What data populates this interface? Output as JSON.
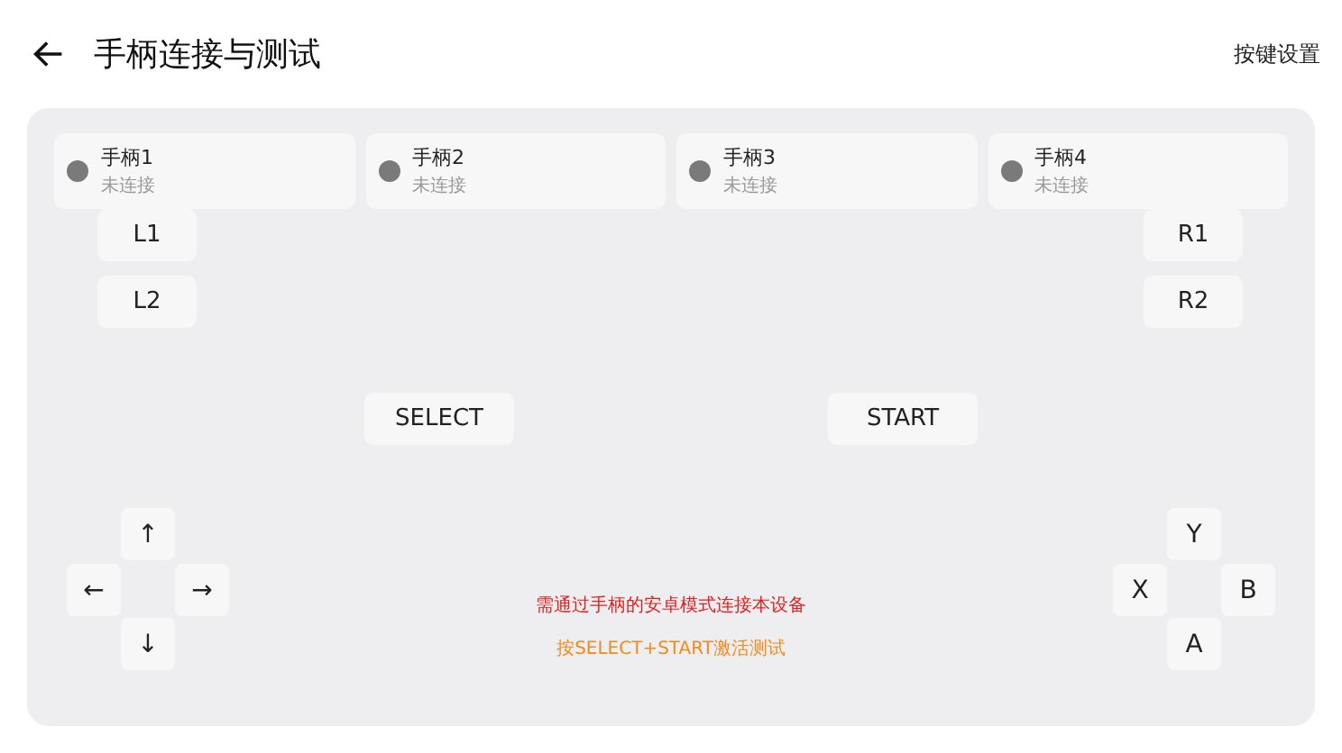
{
  "header": {
    "title": "手柄连接与测试",
    "action": "按键设置"
  },
  "controllers": [
    {
      "name": "手柄1",
      "status": "未连接",
      "connected": false
    },
    {
      "name": "手柄2",
      "status": "未连接",
      "connected": false
    },
    {
      "name": "手柄3",
      "status": "未连接",
      "connected": false
    },
    {
      "name": "手柄4",
      "status": "未连接",
      "connected": false
    }
  ],
  "shoulder_left": [
    "L1",
    "L2"
  ],
  "shoulder_right": [
    "R1",
    "R2"
  ],
  "center_buttons": [
    "SELECT",
    "START"
  ],
  "dpad": {
    "up": "↑",
    "left": "←",
    "right": "→",
    "down": "↓"
  },
  "face_buttons": {
    "top": "Y",
    "left": "X",
    "right": "B",
    "bottom": "A"
  },
  "messages": [
    {
      "text": "需通过手柄的安卓模式连接本设备",
      "kind": "error"
    },
    {
      "text": "按SELECT+START激活测试",
      "kind": "warning"
    }
  ]
}
